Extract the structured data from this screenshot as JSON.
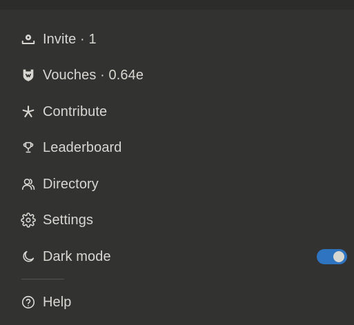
{
  "menu": {
    "invite": {
      "label": "Invite · 1",
      "icon": "invite-icon"
    },
    "vouches": {
      "label": "Vouches · 0.64e",
      "icon": "shield-icon"
    },
    "contribute": {
      "label": "Contribute",
      "icon": "asterisk-icon"
    },
    "leaderboard": {
      "label": "Leaderboard",
      "icon": "trophy-icon"
    },
    "directory": {
      "label": "Directory",
      "icon": "users-icon"
    },
    "settings": {
      "label": "Settings",
      "icon": "gear-icon"
    },
    "dark_mode": {
      "label": "Dark mode",
      "icon": "moon-icon",
      "enabled": true
    },
    "help": {
      "label": "Help",
      "icon": "help-circle-icon"
    }
  },
  "colors": {
    "background": "#323230",
    "text": "#d8d7d2",
    "toggle_on": "#2f74c0"
  }
}
